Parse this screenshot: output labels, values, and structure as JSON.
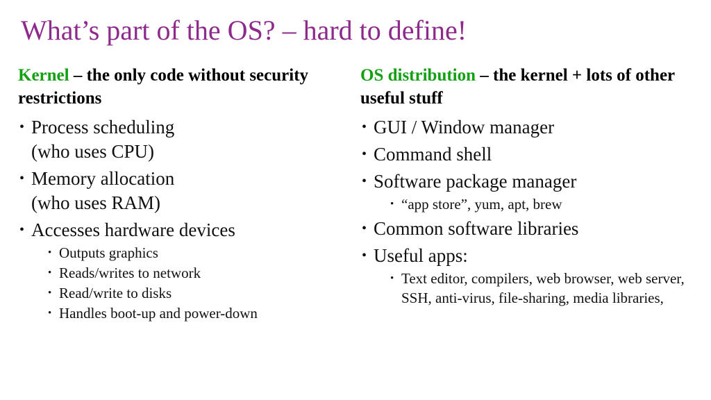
{
  "slide": {
    "title": "What’s part of the OS? – hard to define!",
    "title_color": "#8E2A8B",
    "highlight_color": "#13A013",
    "body_color": "#101010",
    "background": "#FFFFFF"
  },
  "left_column": {
    "heading_highlight": "Kernel",
    "heading_rest": " – the only code without security restrictions",
    "bullets": [
      {
        "text": "Process scheduling (who uses CPU)",
        "line1": "Process scheduling",
        "line2": "(who uses CPU)",
        "sub": []
      },
      {
        "text": "Memory allocation (who uses RAM)",
        "line1": "Memory allocation",
        "line2": "(who uses RAM)",
        "sub": []
      },
      {
        "text": "Accesses hardware devices",
        "line1": "Accesses hardware devices",
        "line2": "",
        "sub": [
          "Outputs graphics",
          "Reads/writes to network",
          "Read/write to disks",
          "Handles boot-up and power-down"
        ]
      }
    ]
  },
  "right_column": {
    "heading_highlight": "OS distribution",
    "heading_rest": " – the kernel + lots of other useful stuff",
    "bullets": [
      {
        "text": "GUI / Window manager",
        "sub": []
      },
      {
        "text": "Command shell",
        "sub": []
      },
      {
        "text": "Software package manager",
        "sub": [
          "“app store”, yum, apt, brew"
        ]
      },
      {
        "text": "Common software libraries",
        "sub": []
      },
      {
        "text": "Useful apps:",
        "sub": [
          "Text editor, compilers, web browser, web server, SSH, anti-virus, file-sharing, media libraries,"
        ]
      }
    ]
  }
}
